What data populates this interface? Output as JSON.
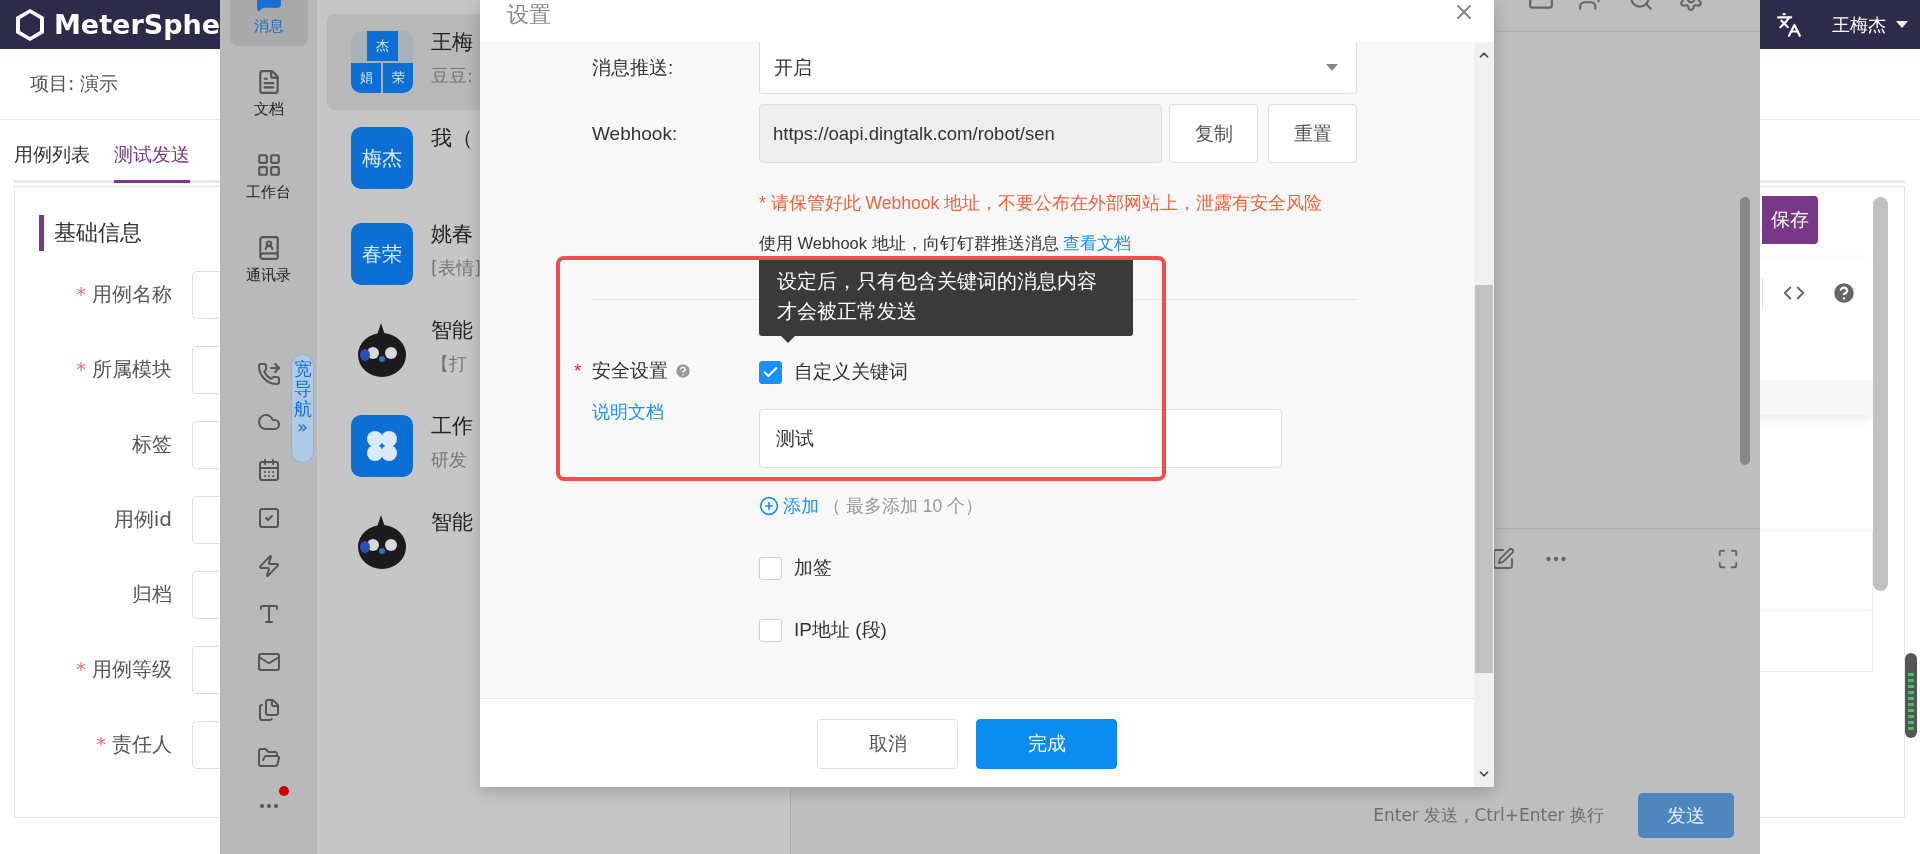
{
  "app_header": {
    "logo": "MeterSphe",
    "user": "王梅杰"
  },
  "project": "项目: 演示",
  "tabs": [
    {
      "label": "用例列表",
      "selected": false
    },
    {
      "label": "测试发送",
      "selected": true
    }
  ],
  "section_title": "基础信息",
  "form_fields": [
    {
      "label": "用例名称",
      "mark": "*"
    },
    {
      "label": "所属模块",
      "mark": "*"
    },
    {
      "label": "标签"
    },
    {
      "label": "用例id"
    },
    {
      "label": "归档"
    },
    {
      "label": "用例等级",
      "mark": "*"
    },
    {
      "label": "责任人",
      "mark": "*"
    }
  ],
  "save_button": "保存",
  "im": {
    "nav": [
      {
        "label": "消息",
        "selected": true
      },
      {
        "label": "文档",
        "selected": false
      },
      {
        "label": "工作台",
        "selected": false
      },
      {
        "label": "通讯录",
        "selected": false
      }
    ],
    "wide_nav": "宽导航",
    "wide_nav_arrow": "»",
    "chats": [
      {
        "name": "王梅",
        "preview": "豆豆:",
        "selected": true,
        "avatar": {
          "kind": "group",
          "chars": [
            "杰",
            "娟",
            "荣"
          ]
        }
      },
      {
        "name": "我（",
        "selected": false,
        "avatar": {
          "kind": "text",
          "text": "梅杰"
        }
      },
      {
        "name": "姚春",
        "preview": "[表情]",
        "selected": false,
        "avatar": {
          "kind": "text",
          "text": "春荣"
        }
      },
      {
        "name": "智能",
        "preview": "【打",
        "selected": false,
        "avatar": {
          "kind": "bot"
        }
      },
      {
        "name": "工作",
        "preview": "研发",
        "selected": false,
        "avatar": {
          "kind": "app"
        }
      },
      {
        "name": "智能",
        "selected": false,
        "avatar": {
          "kind": "bot"
        }
      }
    ],
    "input_hint": "Enter 发送 , Ctrl+Enter 换行",
    "send_button": "发送"
  },
  "dialog": {
    "title": "设置",
    "push_label": "消息推送:",
    "push_value": "开启",
    "webhook_label": "Webhook:",
    "webhook_value": "https://oapi.dingtalk.com/robot/sen",
    "copy_button": "复制",
    "reset_button": "重置",
    "warning": "* 请保管好此 Webhook 地址，不要公布在外部网站上，泄露有安全风险",
    "usage_text": "使用 Webhook 地址，向钉钉群推送消息",
    "usage_link": "查看文档",
    "tooltip": "设定后，只有包含关键词的消息内容才会被正常发送",
    "security_label": "安全设置",
    "security_mark": "*",
    "doc_link": "说明文档",
    "keyword_option": {
      "label": "自定义关键词",
      "checked": true
    },
    "keywords": [
      "测试"
    ],
    "add_link": "添加",
    "add_hint": "（ 最多添加 10 个）",
    "other_options": [
      {
        "label": "加签",
        "checked": false
      },
      {
        "label": "IP地址 (段)",
        "checked": false
      }
    ],
    "cancel_button": "取消",
    "confirm_button": "完成"
  }
}
